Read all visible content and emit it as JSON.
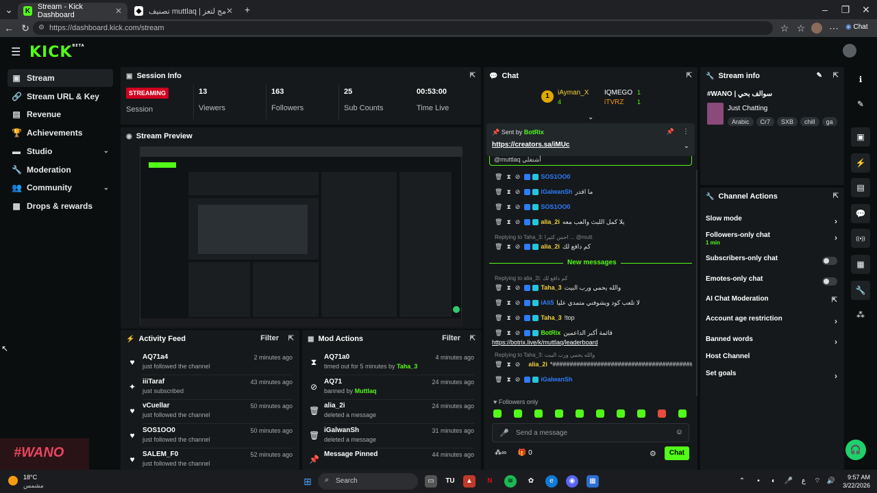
{
  "browser": {
    "tabs": [
      {
        "title": "Stream - Kick Dashboard",
        "active": true
      },
      {
        "title": "تصنيف muttlaq | أفضل برنامج لتعز",
        "active": false
      }
    ],
    "url": "https://dashboard.kick.com/stream",
    "copilot_label": "Chat"
  },
  "brand": {
    "logo": "KICK",
    "beta": "BETA",
    "accent": "#53fc18"
  },
  "sidebar": {
    "items": [
      {
        "label": "Stream",
        "icon": "stream-icon",
        "glyph": "▣",
        "active": true
      },
      {
        "label": "Stream URL & Key",
        "icon": "link-icon",
        "glyph": "🔗"
      },
      {
        "label": "Revenue",
        "icon": "revenue-icon",
        "glyph": "▤"
      },
      {
        "label": "Achievements",
        "icon": "trophy-icon",
        "glyph": "🏆"
      },
      {
        "label": "Studio",
        "icon": "studio-icon",
        "glyph": "▬",
        "chevron": true
      },
      {
        "label": "Moderation",
        "icon": "wrench-icon",
        "glyph": "🔧"
      },
      {
        "label": "Community",
        "icon": "community-icon",
        "glyph": "👥",
        "chevron": true
      },
      {
        "label": "Drops & rewards",
        "icon": "drops-icon",
        "glyph": "▦"
      }
    ]
  },
  "session": {
    "title": "Session Info",
    "status": "STREAMING",
    "status_label": "Session",
    "stats": [
      {
        "value": "13",
        "label": "Viewers"
      },
      {
        "value": "163",
        "label": "Followers"
      },
      {
        "value": "25",
        "label": "Sub Counts"
      },
      {
        "value": "00:53:00",
        "label": "Time Live"
      }
    ]
  },
  "preview": {
    "title": "Stream Preview"
  },
  "activity": {
    "title": "Activity Feed",
    "filter": "Filter",
    "rows": [
      {
        "icon": "heart-icon",
        "glyph": "♥",
        "name": "AQ71a4",
        "desc": "just followed the channel",
        "time": "2 minutes ago"
      },
      {
        "icon": "sparkle-icon",
        "glyph": "✦",
        "name": "iiiTaraf",
        "desc": "just subscribed",
        "time": "43 minutes ago"
      },
      {
        "icon": "heart-icon",
        "glyph": "♥",
        "name": "vCuellar",
        "desc": "just followed the channel",
        "time": "50 minutes ago"
      },
      {
        "icon": "heart-icon",
        "glyph": "♥",
        "name": "SOS1OO0",
        "desc": "just followed the channel",
        "time": "50 minutes ago"
      },
      {
        "icon": "heart-icon",
        "glyph": "♥",
        "name": "SALEM_F0",
        "desc": "just followed the channel",
        "time": "52 minutes ago"
      }
    ]
  },
  "mod": {
    "title": "Mod Actions",
    "filter": "Filter",
    "rows": [
      {
        "icon": "hourglass-icon",
        "glyph": "⧗",
        "name": "AQ71a0",
        "desc": "timed out for 5 minutes by",
        "by": "Taha_3",
        "time": "4 minutes ago"
      },
      {
        "icon": "ban-icon",
        "glyph": "⊘",
        "name": "AQ71",
        "desc": "banned by",
        "by": "Muttlaq",
        "time": "24 minutes ago"
      },
      {
        "icon": "trash-icon",
        "glyph": "🗑",
        "name": "alia_2i",
        "desc": "deleted a message",
        "by": "",
        "time": "24 minutes ago"
      },
      {
        "icon": "trash-icon",
        "glyph": "🗑",
        "name": "iGalwanSh",
        "desc": "deleted a message",
        "by": "",
        "time": "31 minutes ago"
      },
      {
        "icon": "pin-icon",
        "glyph": "📌",
        "name": "Message Pinned",
        "desc": "",
        "by": "",
        "time": "44 minutes ago"
      }
    ]
  },
  "chat": {
    "title": "Chat",
    "top_gifters": [
      {
        "rank": "1",
        "name": "iAyman_X",
        "count": "4"
      },
      {
        "rank": "",
        "name": "IQMEGO",
        "count": "1"
      },
      {
        "rank": "",
        "name": "iTVRZ",
        "count": "1"
      }
    ],
    "pinned": {
      "prefix": "Sent by",
      "user": "BotRix",
      "link": "https://creators.sa/iMUc"
    },
    "reply_fragment": "@muttlaq أشتغلي",
    "messages": [
      {
        "user": "SOS1OO0",
        "color": "#2d7cff",
        "text": ""
      },
      {
        "user": "iGalwanSh",
        "color": "#2d7cff",
        "text": "ما اقدر"
      },
      {
        "user": "SOS1OO0",
        "color": "#2d7cff",
        "text": ""
      },
      {
        "user": "alia_2i",
        "color": "#f4d03f",
        "text": "يلا كمل اللبث والعب معه"
      },
      {
        "reply": "Replying to Taha_3: احس كثيرا ... @mutt",
        "user": "alia_2i",
        "color": "#f4d03f",
        "text": "كم دافع لك"
      },
      {
        "divider": "New messages"
      },
      {
        "reply": "Replying to alia_2i: كم دافع لك",
        "user": "Taha_3",
        "color": "#f4d03f",
        "text": "والله يحمي ورب البيت"
      },
      {
        "user": "iAli5",
        "color": "#2d7cff",
        "text": "لا تلعب كود ويشوفني متمدي عليا"
      },
      {
        "user": "Taha_3",
        "color": "#f4d03f",
        "text": "!top"
      },
      {
        "user": "BotRix",
        "color": "#53fc18",
        "text": "قائمة أكبر الداعمين",
        "link": "https://botrix.live/k/muttlaq/leaderboard"
      },
      {
        "reply": "Replying to Taha_3: والله يحمي ورب البيت",
        "user": "alia_2i",
        "color": "#f4d03f",
        "text": "*##########################################*"
      },
      {
        "user": "iGalwanSh",
        "color": "#2d7cff",
        "text": ""
      }
    ],
    "followers_only": "Followers only",
    "input_placeholder": "Send a message",
    "points": "0",
    "send_label": "Chat"
  },
  "stream_info": {
    "title": "Stream info",
    "stream_title": "#WANO | سوالف بحي",
    "category": "Just Chatting",
    "tags": [
      "Arabic",
      "Cr7",
      "SXB",
      "chill",
      "ga"
    ]
  },
  "channel_actions": {
    "title": "Channel Actions",
    "items": [
      {
        "label": "Slow mode",
        "type": "chevron"
      },
      {
        "label": "Followers-only chat",
        "type": "chevron",
        "sub": "1 min"
      },
      {
        "label": "Subscribers-only chat",
        "type": "toggle"
      },
      {
        "label": "Emotes-only chat",
        "type": "toggle"
      },
      {
        "label": "AI Chat Moderation",
        "type": "external"
      },
      {
        "label": "Account age restriction",
        "type": "chevron"
      },
      {
        "label": "Banned words",
        "type": "chevron"
      },
      {
        "label": "Host Channel",
        "type": "none"
      },
      {
        "label": "Set goals",
        "type": "chevron"
      }
    ]
  },
  "taskbar": {
    "weather_temp": "18°C",
    "weather_text": "مشمس",
    "search": "Search",
    "time": "9:57 AM",
    "date": "3/22/2026"
  },
  "overlay_text": "#WANO"
}
